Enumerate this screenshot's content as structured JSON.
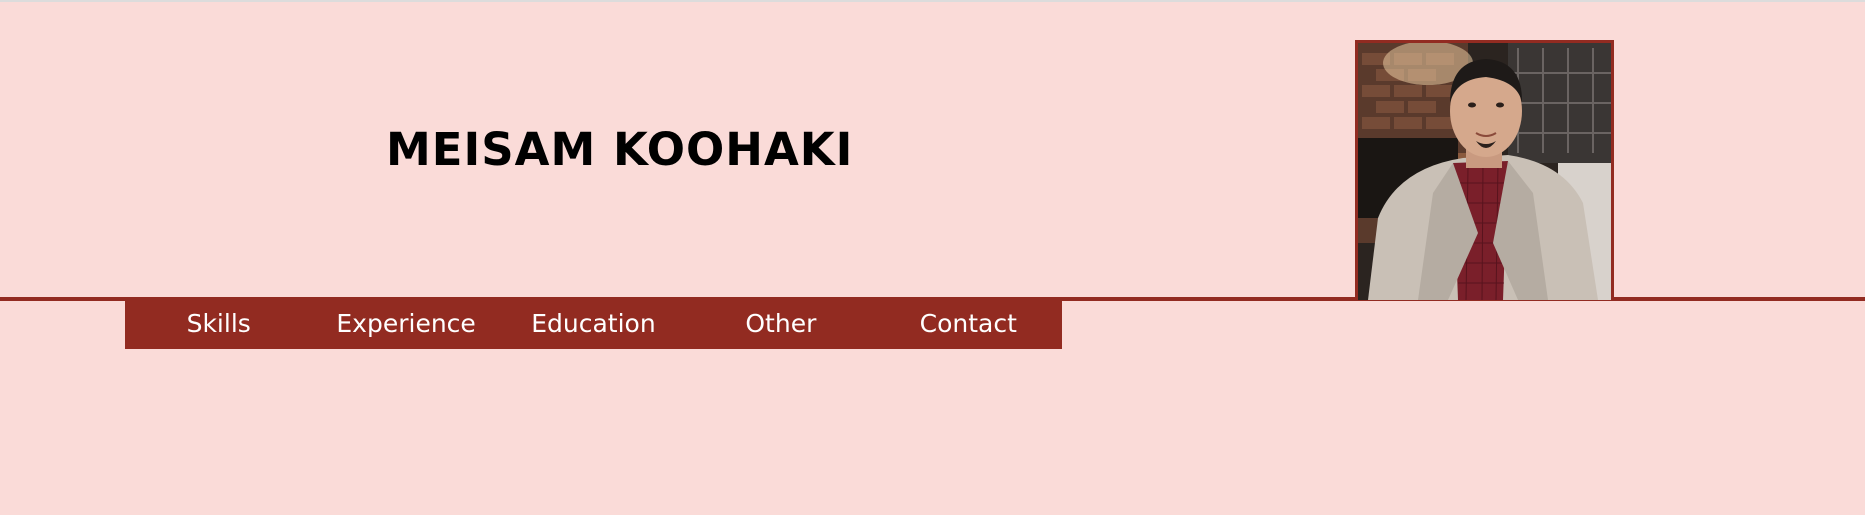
{
  "header": {
    "name": "MEISAM KOOHAKI"
  },
  "nav": {
    "items": [
      {
        "label": "Skills"
      },
      {
        "label": "Experience"
      },
      {
        "label": "Education"
      },
      {
        "label": "Other"
      },
      {
        "label": "Contact"
      }
    ]
  },
  "profile_photo": {
    "icon": "profile-photo"
  },
  "colors": {
    "background": "#fadbd8",
    "accent": "#922b21",
    "nav_text": "#ffffff",
    "heading_text": "#000000"
  }
}
